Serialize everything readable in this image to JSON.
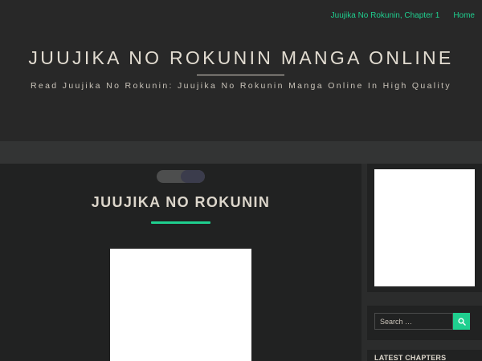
{
  "nav": {
    "items": [
      {
        "label": "Juujika No Rokunin, Chapter 1"
      },
      {
        "label": "Home"
      }
    ]
  },
  "site": {
    "title": "JUUJIKA NO ROKUNIN MANGA ONLINE",
    "tagline": "Read Juujika No Rokunin: Juujika No Rokunin Manga Online In High Quality"
  },
  "post": {
    "title": "JUUJIKA NO ROKUNIN"
  },
  "sidebar": {
    "search": {
      "placeholder": "Search …",
      "icon": "search-icon"
    },
    "latest_chapters": {
      "heading": "LATEST CHAPTERS"
    }
  },
  "colors": {
    "accent": "#1fcf8f",
    "header_bg": "#282828",
    "content_bg": "#212222",
    "band_bg": "#333434"
  }
}
